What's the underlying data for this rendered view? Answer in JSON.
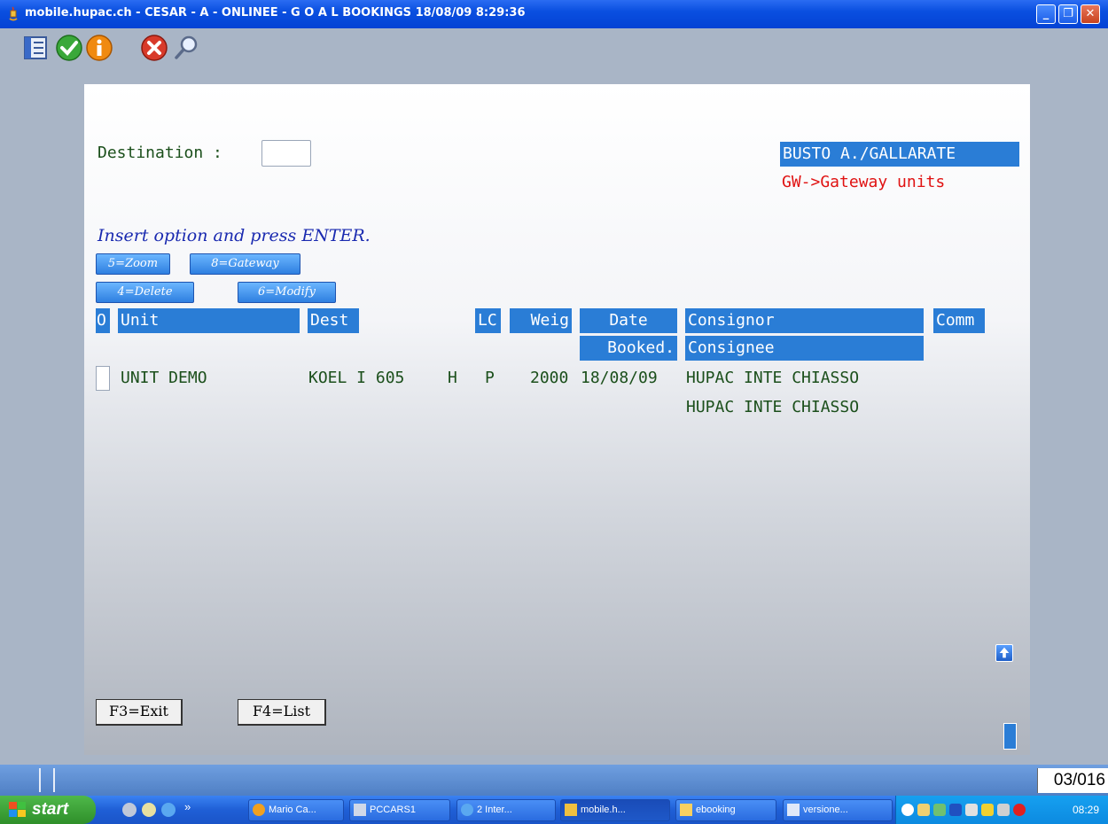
{
  "window": {
    "title": "mobile.hupac.ch - CESAR - A - ONLINEE - G O A L  BOOKINGS 18/08/09   8:29:36",
    "minimize_glyph": "_",
    "restore_glyph": "❐",
    "close_glyph": "✕"
  },
  "toolbar": {
    "icons": [
      "list-icon",
      "check-icon",
      "info-icon",
      "cancel-icon",
      "search-icon"
    ]
  },
  "form": {
    "destination_label": "Destination :",
    "destination_value": "",
    "banner": "BUSTO A./GALLARATE",
    "gateway_note": "GW->Gateway units",
    "instruction": "Insert option and press ENTER.",
    "options": [
      "5=Zoom",
      "8=Gateway",
      "4=Delete",
      "6=Modify"
    ]
  },
  "table": {
    "headers": {
      "o": "O",
      "unit": "Unit",
      "dest": "Dest",
      "lc": "LC",
      "weig": "Weig",
      "date": "Date",
      "booked": "Booked.",
      "consignor": "Consignor",
      "consignee": "Consignee",
      "comm": "Comm"
    },
    "rows": [
      {
        "unit": "UNIT DEMO",
        "dest": "KOEL I 605",
        "h": "H",
        "p": "P",
        "weight": "2000",
        "date": "18/08/09",
        "consignor": "HUPAC INTE CHIASSO",
        "consignee": "HUPAC INTE CHIASSO"
      }
    ]
  },
  "function_keys": [
    "F3=Exit",
    "F4=List"
  ],
  "statusbar": {
    "counter": "03/016"
  },
  "taskbar": {
    "start_label": "start",
    "more_glyph": "»",
    "tasks": [
      "Mario Ca...",
      "PCCARS1",
      "2 Inter...",
      "mobile.h...",
      "ebooking",
      "versione..."
    ],
    "clock": "08:29"
  }
}
